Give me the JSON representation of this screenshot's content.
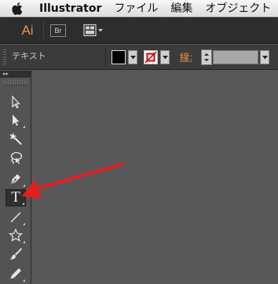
{
  "menubar": {
    "apple": "apple-icon",
    "app_name": "Illustrator",
    "items": [
      "ファイル",
      "編集",
      "オブジェクト"
    ]
  },
  "appbar": {
    "logo_text": "Ai",
    "bridge_label": "Br",
    "arrange_icon": "arrange-documents-icon"
  },
  "control_panel": {
    "selection_type": "テキスト",
    "fill_color": "#000000",
    "stroke_color": "none",
    "stroke_label": "線",
    "stroke_colon": ":",
    "stroke_weight": ""
  },
  "tools": [
    {
      "name": "selection-tool",
      "icon": "arrow-icon"
    },
    {
      "name": "direct-selection-tool",
      "icon": "direct-arrow-icon"
    },
    {
      "name": "magic-wand-tool",
      "icon": "magic-wand-icon"
    },
    {
      "name": "lasso-tool",
      "icon": "lasso-icon"
    },
    {
      "name": "pen-tool",
      "icon": "pen-icon"
    },
    {
      "name": "type-tool",
      "icon": "type-icon",
      "glyph": "T",
      "active": true
    },
    {
      "name": "line-segment-tool",
      "icon": "line-icon"
    },
    {
      "name": "star-tool",
      "icon": "star-icon"
    },
    {
      "name": "paintbrush-tool",
      "icon": "paintbrush-icon"
    },
    {
      "name": "pencil-tool",
      "icon": "pencil-icon"
    }
  ],
  "annotation": {
    "color": "#e02020",
    "icon": "red-arrow-pointer"
  }
}
